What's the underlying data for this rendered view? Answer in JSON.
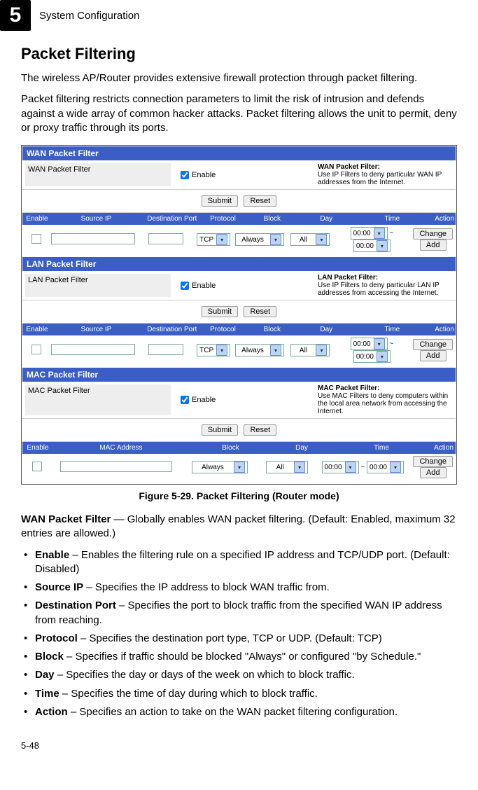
{
  "chapter": {
    "number": "5",
    "title": "System Configuration"
  },
  "section_title": "Packet Filtering",
  "para1": "The wireless AP/Router provides extensive firewall protection through packet filtering.",
  "para2": "Packet filtering restricts connection parameters to limit the risk of intrusion and defends against a wide array of common hacker attacks. Packet filtering allows the unit to permit, deny or proxy traffic through its ports.",
  "screenshot": {
    "wan": {
      "header": "WAN Packet Filter",
      "label": "WAN Packet Filter",
      "enable_label": "Enable",
      "help_title": "WAN Packet Filter:",
      "help_text": "Use IP Filters to deny particular WAN IP addresses from the Internet.",
      "submit": "Submit",
      "reset": "Reset",
      "thead": {
        "enable": "Enable",
        "src": "Source IP",
        "port": "Destination Port",
        "proto": "Protocol",
        "block": "Block",
        "day": "Day",
        "time": "Time",
        "action": "Action"
      },
      "row": {
        "proto": "TCP",
        "block": "Always",
        "day": "All",
        "t1": "00:00",
        "tilde": "~",
        "t2": "00:00",
        "change": "Change",
        "add": "Add"
      }
    },
    "lan": {
      "header": "LAN Packet Filter",
      "label": "LAN Packet Filter",
      "enable_label": "Enable",
      "help_title": "LAN Packet Filter:",
      "help_text": "Use IP Filters to deny particular LAN IP addresses from accessing the Internet.",
      "submit": "Submit",
      "reset": "Reset",
      "thead": {
        "enable": "Enable",
        "src": "Source IP",
        "port": "Destination Port",
        "proto": "Protocol",
        "block": "Block",
        "day": "Day",
        "time": "Time",
        "action": "Action"
      },
      "row": {
        "proto": "TCP",
        "block": "Always",
        "day": "All",
        "t1": "00:00",
        "tilde": "~",
        "t2": "00:00",
        "change": "Change",
        "add": "Add"
      }
    },
    "mac": {
      "header": "MAC Packet Filter",
      "label": "MAC Packet Filter",
      "enable_label": "Enable",
      "help_title": "MAC Packet Filter:",
      "help_text": "Use MAC Filters to deny computers within the local area network from accessing the Internet.",
      "submit": "Submit",
      "reset": "Reset",
      "thead": {
        "enable": "Enable",
        "mac": "MAC Address",
        "block": "Block",
        "day": "Day",
        "time": "Time",
        "action": "Action"
      },
      "row": {
        "block": "Always",
        "day": "All",
        "t1": "00:00",
        "tilde": "~",
        "t2": "00:00",
        "change": "Change",
        "add": "Add"
      }
    }
  },
  "figure_caption": "Figure 5-29.   Packet Filtering (Router mode)",
  "wan_desc_label": "WAN Packet Filter",
  "wan_desc_text": " — Globally enables WAN packet filtering. (Default: Enabled, maximum 32 entries are allowed.)",
  "bullets": [
    {
      "label": "Enable",
      "text": " – Enables the filtering rule on a specified IP address and TCP/UDP port. (Default: Disabled)"
    },
    {
      "label": "Source IP",
      "text": " – Specifies the IP address to block WAN traffic from."
    },
    {
      "label": "Destination Port",
      "text": " – Specifies the port to block traffic from the specified WAN IP address from reaching."
    },
    {
      "label": "Protocol",
      "text": " – Specifies the destination port type, TCP or UDP. (Default: TCP)"
    },
    {
      "label": "Block",
      "text": " – Specifies if traffic should be blocked \"Always\" or configured \"by Schedule.\""
    },
    {
      "label": "Day",
      "text": " – Specifies the day or days of the week on which to block traffic."
    },
    {
      "label": "Time",
      "text": " – Specifies the time of day during which to block traffic."
    },
    {
      "label": "Action",
      "text": " – Specifies an action to take on the WAN packet filtering configuration."
    }
  ],
  "page_number": "5-48"
}
